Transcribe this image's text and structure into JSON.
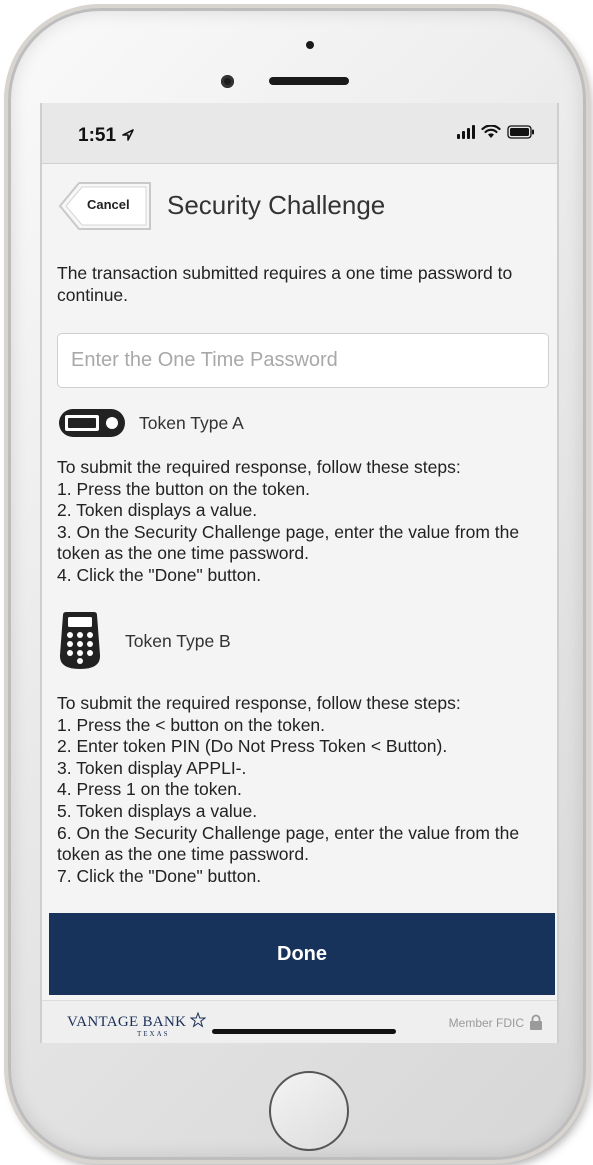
{
  "status_bar": {
    "time": "1:51"
  },
  "header": {
    "cancel_label": "Cancel",
    "title": "Security Challenge"
  },
  "intro_text": "The transaction submitted requires a one time password to continue.",
  "otp_input": {
    "placeholder": "Enter the One Time Password",
    "value": ""
  },
  "token_a": {
    "label": "Token Type A",
    "steps": [
      "To submit the required response, follow these steps:",
      "1. Press the button on the token.",
      "2. Token displays a value.",
      "3. On the Security Challenge page, enter the value from the token as the one time password.",
      "4. Click the \"Done\" button."
    ]
  },
  "token_b": {
    "label": "Token Type B",
    "steps": [
      "To submit the required response, follow these steps:",
      "1. Press the < button on the token.",
      "2. Enter token PIN (Do Not Press Token < Button).",
      "3. Token display APPLI-.",
      "4. Press 1 on the token.",
      "5. Token displays a value.",
      "6. On the Security Challenge page, enter the value from the token as the one time password.",
      "7. Click the \"Done\" button."
    ]
  },
  "done_label": "Done",
  "footer": {
    "brand": "VANTAGE BANK",
    "brand_sub": "TEXAS",
    "fdic": "Member FDIC"
  },
  "colors": {
    "primary": "#17325b",
    "background": "#f4f4f4",
    "status_bar": "#e8e8e8"
  }
}
